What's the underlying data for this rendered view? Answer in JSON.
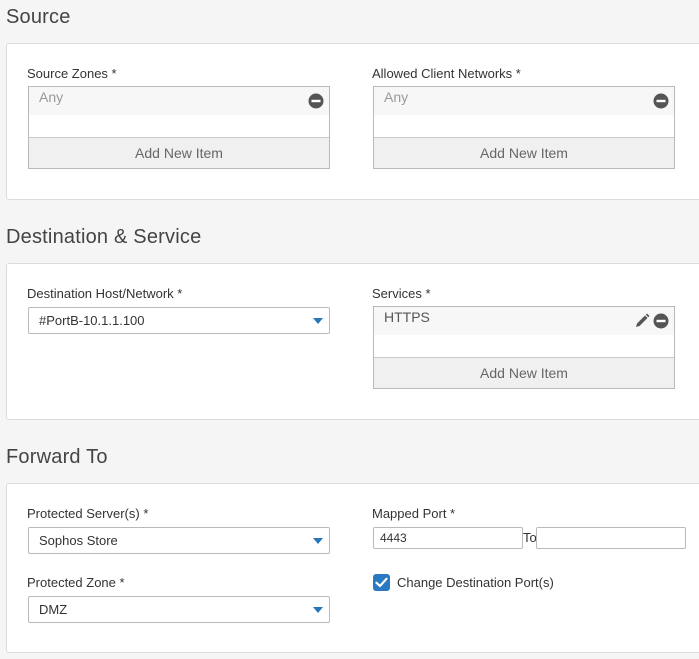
{
  "source": {
    "title": "Source",
    "source_zones": {
      "label": "Source Zones *",
      "item": "Any",
      "add_label": "Add New Item"
    },
    "allowed_networks": {
      "label": "Allowed Client Networks *",
      "item": "Any",
      "add_label": "Add New Item"
    }
  },
  "destination": {
    "title": "Destination & Service",
    "host": {
      "label": "Destination Host/Network *",
      "value": "#PortB-10.1.1.100"
    },
    "services": {
      "label": "Services *",
      "item": "HTTPS",
      "add_label": "Add New Item"
    }
  },
  "forward": {
    "title": "Forward To",
    "protected_server": {
      "label": "Protected Server(s) *",
      "value": "Sophos Store"
    },
    "mapped_port": {
      "label": "Mapped Port *",
      "value": "4443",
      "to_label": "To",
      "to_value": ""
    },
    "protected_zone": {
      "label": "Protected Zone *",
      "value": "DMZ"
    },
    "change_port": {
      "label": "Change Destination Port(s)",
      "checked": true
    }
  },
  "colors": {
    "accent": "#2676b8",
    "checkbox": "#2a7ac3"
  }
}
